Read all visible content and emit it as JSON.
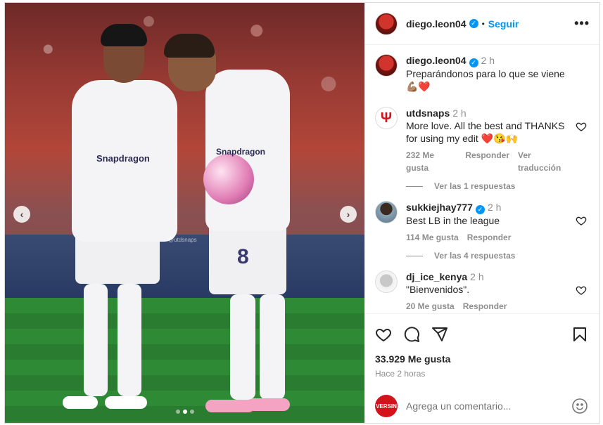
{
  "post": {
    "author": "diego.leon04",
    "follow_label": "Seguir",
    "separator": "•",
    "more_label": "•••",
    "photo": {
      "watermark": "@utdsnaps",
      "sponsor_left": "Snapdragon",
      "sponsor_right": "Snapdragon",
      "shirt_number": "8",
      "prev_arrow": "‹",
      "next_arrow": "›",
      "slide_count": 3,
      "active_slide": 2
    }
  },
  "comments": [
    {
      "user": "diego.leon04",
      "verified": true,
      "time": "2 h",
      "text": "Preparándonos para lo que se viene 💪🏽❤️",
      "likes": "",
      "reply_label": "",
      "translate_label": ""
    },
    {
      "user": "utdsnaps",
      "verified": false,
      "time": "2 h",
      "text": "More love. All the best and THANKS for using my edit ❤️😘🙌",
      "likes": "232 Me gusta",
      "reply_label": "Responder",
      "translate_label": "Ver traducción",
      "view_replies": "Ver las 1 respuestas"
    },
    {
      "user": "sukkiejhay777",
      "verified": true,
      "time": "2 h",
      "text": "Best LB in the league",
      "likes": "114 Me gusta",
      "reply_label": "Responder",
      "view_replies": "Ver las 4 respuestas"
    },
    {
      "user": "dj_ice_kenya",
      "verified": false,
      "time": "2 h",
      "text": "\"Bienvenidos\".",
      "likes": "20 Me gusta",
      "reply_label": "Responder"
    }
  ],
  "stats": {
    "likes": "33.929 Me gusta",
    "ago": "Hace 2 horas"
  },
  "composer": {
    "placeholder": "Agrega un comentario...",
    "avatar_text": "VERSIN"
  },
  "colors": {
    "accent": "#0095f6",
    "text": "#262626",
    "muted": "#8e8e8e",
    "heart_red": "#ed4956"
  },
  "icons": [
    "heart-icon",
    "comment-icon",
    "share-icon",
    "bookmark-icon",
    "emoji-icon",
    "verified-icon",
    "more-icon"
  ]
}
